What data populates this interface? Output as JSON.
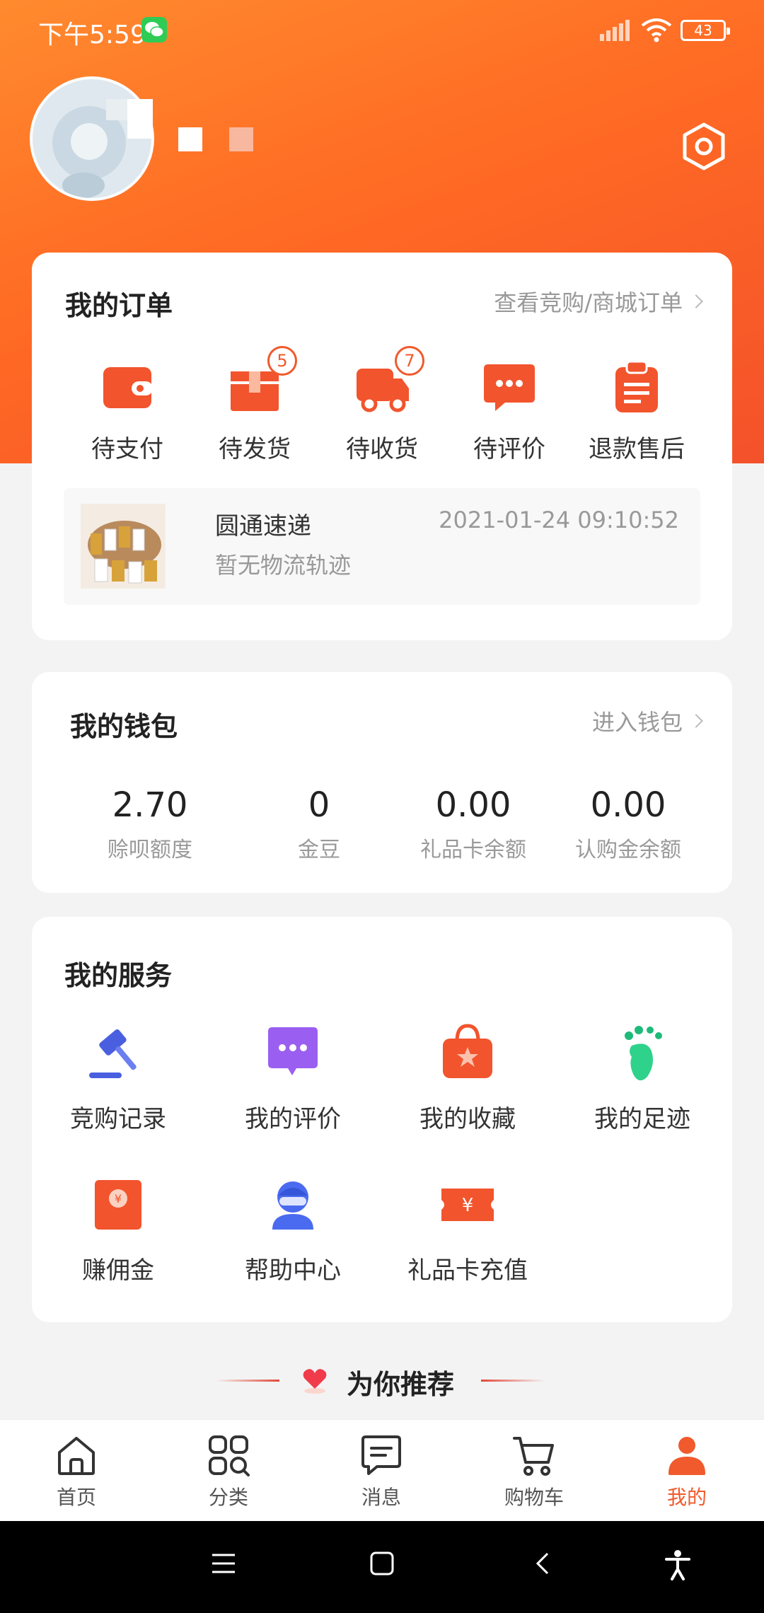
{
  "status_bar": {
    "time": "下午5:59",
    "battery": "43"
  },
  "orders": {
    "title": "我的订单",
    "link": "查看竞购/商城订单",
    "items": [
      {
        "label": "待支付",
        "icon": "wallet-icon"
      },
      {
        "label": "待发货",
        "icon": "package-icon",
        "badge": "5"
      },
      {
        "label": "待收货",
        "icon": "truck-icon",
        "badge": "7"
      },
      {
        "label": "待评价",
        "icon": "chat-dots-icon"
      },
      {
        "label": "退款售后",
        "icon": "clipboard-icon"
      }
    ],
    "logistics": {
      "courier": "圆通速递",
      "status": "暂无物流轨迹",
      "time": "2021-01-24 09:10:52"
    }
  },
  "wallet": {
    "title": "我的钱包",
    "link": "进入钱包",
    "items": [
      {
        "value": "2.70",
        "label": "赊呗额度"
      },
      {
        "value": "0",
        "label": "金豆"
      },
      {
        "value": "0.00",
        "label": "礼品卡余额"
      },
      {
        "value": "0.00",
        "label": "认购金余额"
      }
    ]
  },
  "services": {
    "title": "我的服务",
    "items": [
      {
        "label": "竞购记录",
        "icon": "gavel-icon"
      },
      {
        "label": "我的评价",
        "icon": "comment-icon"
      },
      {
        "label": "我的收藏",
        "icon": "favorites-bag-icon"
      },
      {
        "label": "我的足迹",
        "icon": "footprint-icon"
      },
      {
        "label": "赚佣金",
        "icon": "red-envelope-icon"
      },
      {
        "label": "帮助中心",
        "icon": "help-agent-icon"
      },
      {
        "label": "礼品卡充值",
        "icon": "gift-card-icon"
      }
    ]
  },
  "recommend": {
    "title": "为你推荐"
  },
  "tabbar": {
    "items": [
      {
        "label": "首页",
        "icon": "home-icon"
      },
      {
        "label": "分类",
        "icon": "category-icon"
      },
      {
        "label": "消息",
        "icon": "message-icon"
      },
      {
        "label": "购物车",
        "icon": "cart-icon"
      },
      {
        "label": "我的",
        "icon": "profile-icon",
        "active": true
      }
    ]
  },
  "colors": {
    "brand": "#f05a2c",
    "hero_start": "#ff8a2e",
    "hero_end": "#f4512a"
  }
}
